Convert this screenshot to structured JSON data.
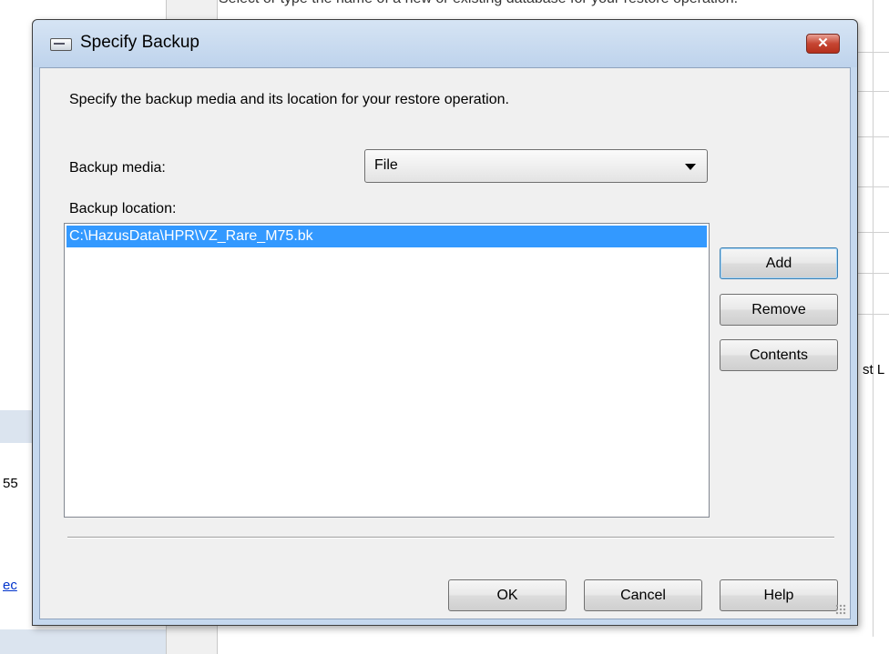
{
  "background": {
    "header_text": "Select or type the name of a new or existing database for your restore operation.",
    "left_number": "55",
    "left_link": "ec",
    "right_text": "st L"
  },
  "dialog": {
    "title": "Specify Backup",
    "close_glyph": "✕",
    "instructions": "Specify the backup media and its location for your restore operation.",
    "backup_media_label": "Backup media:",
    "backup_media_value": "File",
    "backup_location_label": "Backup location:",
    "locations": [
      "C:\\HazusData\\HPR\\VZ_Rare_M75.bk"
    ],
    "buttons": {
      "add": "Add",
      "remove": "Remove",
      "contents": "Contents",
      "ok": "OK",
      "cancel": "Cancel",
      "help": "Help"
    }
  },
  "colors": {
    "selection": "#3399ff",
    "dialog_frame": "#c5d8ee",
    "close_button": "#c64532"
  }
}
